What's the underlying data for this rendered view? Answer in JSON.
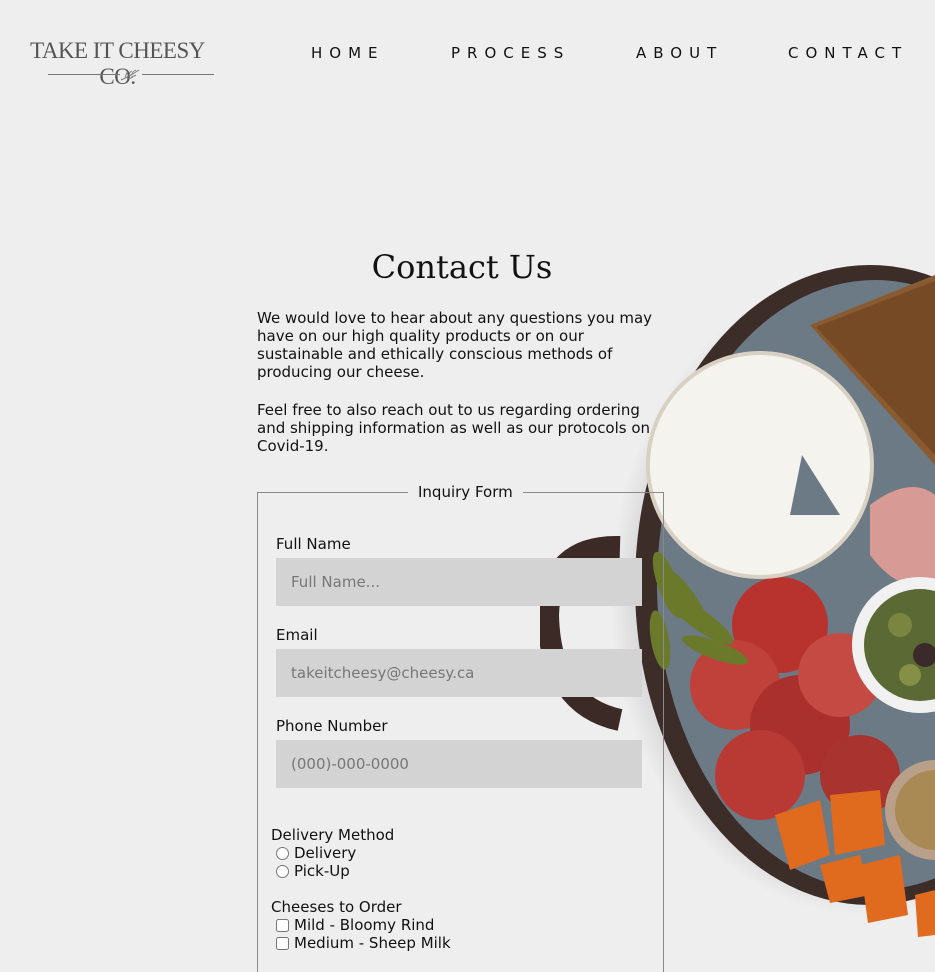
{
  "header": {
    "logo_text": "TAKE IT CHEESY CO.",
    "nav": [
      {
        "label": "HOME"
      },
      {
        "label": "PROCESS"
      },
      {
        "label": "ABOUT"
      },
      {
        "label": "CONTACT"
      }
    ]
  },
  "main": {
    "title": "Contact Us",
    "intro_1": "We would love to hear about any questions you may have on our high quality products or on our sustainable and ethically conscious methods of producing our cheese.",
    "intro_2": "Feel free to also reach out to us regarding ordering and shipping information as well as our protocols on Covid-19."
  },
  "form": {
    "legend": "Inquiry Form",
    "full_name": {
      "label": "Full Name",
      "placeholder": "Full Name..."
    },
    "email": {
      "label": "Email",
      "placeholder": "takeitcheesy@cheesy.ca"
    },
    "phone": {
      "label": "Phone Number",
      "placeholder": "(000)-000-0000"
    },
    "delivery": {
      "title": "Delivery Method",
      "options": [
        "Delivery",
        "Pick-Up"
      ]
    },
    "cheeses": {
      "title": "Cheeses to Order",
      "options": [
        "Mild - Bloomy Rind",
        "Medium - Sheep Milk"
      ]
    }
  },
  "colors": {
    "background": "#eeeeee",
    "input_bg": "#d3d3d3",
    "text": "#111111"
  }
}
